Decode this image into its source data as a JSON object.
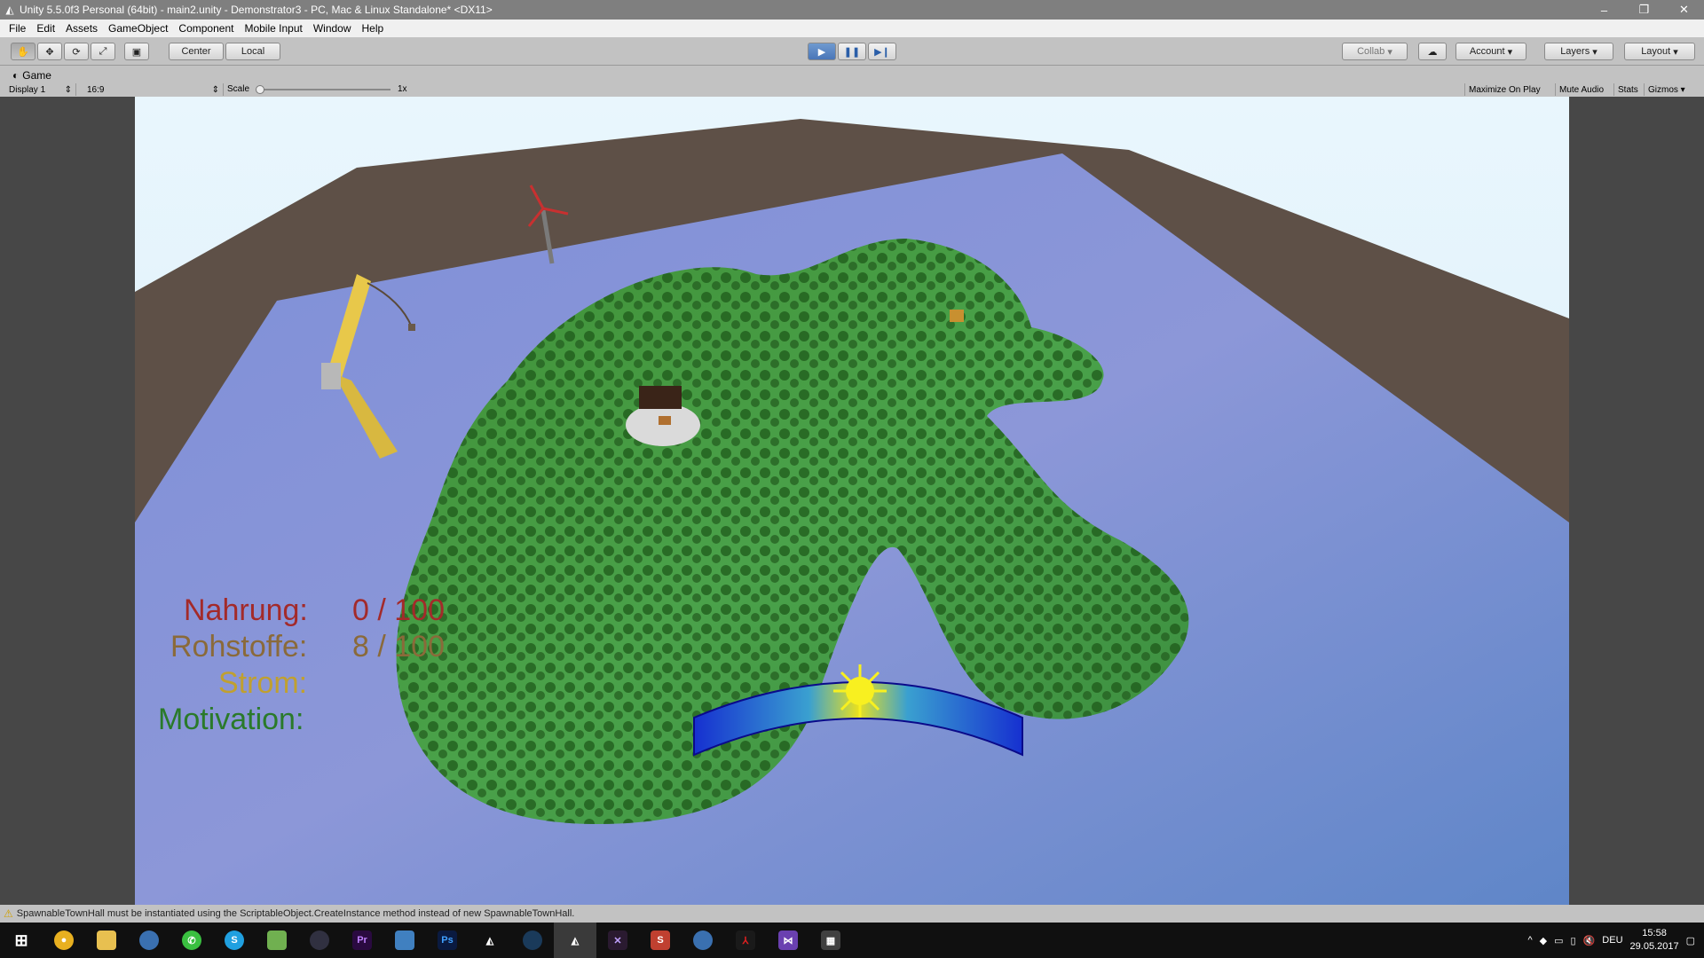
{
  "window": {
    "title": "Unity 5.5.0f3 Personal (64bit) - main2.unity - Demonstrator3 - PC, Mac & Linux Standalone* <DX11>",
    "controls": [
      "minimize-icon",
      "restore-icon",
      "close-icon"
    ]
  },
  "menu": [
    "File",
    "Edit",
    "Assets",
    "GameObject",
    "Component",
    "Mobile Input",
    "Window",
    "Help"
  ],
  "toolbar": {
    "pivot": "Center",
    "space": "Local",
    "collab": "Collab",
    "account": "Account",
    "layers": "Layers",
    "layout": "Layout"
  },
  "game_view": {
    "tab": "Game",
    "display": "Display 1",
    "aspect": "16:9",
    "scale_label": "Scale",
    "scale_value": "1x",
    "maximize": "Maximize On Play",
    "mute": "Mute Audio",
    "stats": "Stats",
    "gizmos": "Gizmos"
  },
  "hud": {
    "food_label": "Nahrung:",
    "food_value": "0 / 100",
    "resources_label": "Rohstoffe:",
    "resources_value": "8 / 100",
    "power_label": "Strom:",
    "motivation_label": "Motivation:",
    "colors": {
      "food": "#a32a2a",
      "resources": "#8a6a3a",
      "power": "#c0a030",
      "motivation": "#2a7a2a"
    }
  },
  "status": {
    "message": "SpawnableTownHall must be instantiated using the ScriptableObject.CreateInstance method instead of new SpawnableTownHall."
  },
  "taskbar": {
    "apps": [
      "windows-icon",
      "chrome-icon",
      "explorer-icon",
      "thunderbird-icon",
      "whatsapp-icon",
      "skype-icon",
      "notepad-icon",
      "obs-icon",
      "premiere-icon",
      "paint-icon",
      "photoshop-icon",
      "unity-icon",
      "steam-icon",
      "unity-active-icon",
      "blender-icon",
      "sketch-icon",
      "thunderbird2-icon",
      "acrobat-icon",
      "visualstudio-icon",
      "calculator-icon"
    ],
    "language": "DEU",
    "time": "15:58",
    "date": "29.05.2017"
  }
}
